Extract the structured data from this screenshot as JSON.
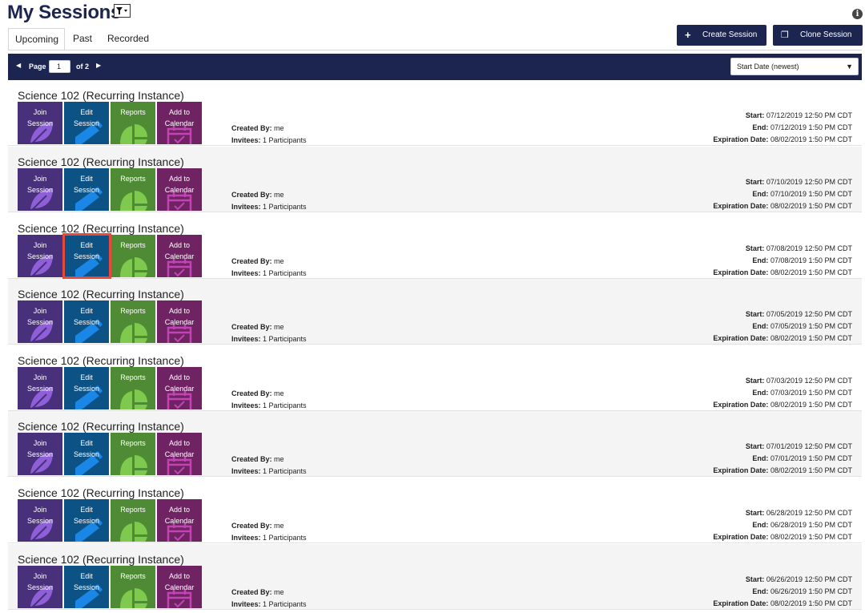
{
  "header": {
    "title": "My Sessions",
    "filter_icon": "funnel-icon",
    "info_icon": "info-icon",
    "info_glyph": "i"
  },
  "tabs": [
    {
      "label": "Upcoming",
      "active": true
    },
    {
      "label": "Past",
      "active": false
    },
    {
      "label": "Recorded",
      "active": false
    }
  ],
  "actions": {
    "create_label": "Create Session",
    "create_icon_glyph": "+",
    "clone_label": "Clone Session",
    "clone_icon_glyph": "❐"
  },
  "pager": {
    "prev_glyph": "◀",
    "next_glyph": "▶",
    "page_label": "Page",
    "page_value": "1",
    "of_label": "of 2",
    "sort_value": "Start Date (newest)",
    "sort_caret": "▼"
  },
  "labels": {
    "join": [
      "Join",
      "Session"
    ],
    "edit": [
      "Edit",
      "Session"
    ],
    "reports": "Reports",
    "calendar": [
      "Add to",
      "Calendar"
    ],
    "created_by": "Created By:",
    "invitees": "Invitees:",
    "start": "Start:",
    "end": "End:",
    "expiration": "Expiration Date:"
  },
  "colors": {
    "navy": "#1b2550",
    "join": "#48307a",
    "edit": "#0c5285",
    "reports": "#4f8a35",
    "calendar": "#6f2363",
    "highlight": "#e74a3b"
  },
  "sessions": [
    {
      "title": "Science 102 (Recurring Instance)",
      "created_by": "me",
      "invitees": "1 Participants",
      "start": "07/12/2019 12:50 PM CDT",
      "end": "07/12/2019 1:50 PM CDT",
      "expiration": "08/02/2019 1:50 PM CDT"
    },
    {
      "title": "Science 102 (Recurring Instance)",
      "created_by": "me",
      "invitees": "1 Participants",
      "start": "07/10/2019 12:50 PM CDT",
      "end": "07/10/2019 1:50 PM CDT",
      "expiration": "08/02/2019 1:50 PM CDT"
    },
    {
      "title": "Science 102 (Recurring Instance)",
      "created_by": "me",
      "invitees": "1 Participants",
      "start": "07/08/2019 12:50 PM CDT",
      "end": "07/08/2019 1:50 PM CDT",
      "expiration": "08/02/2019 1:50 PM CDT",
      "highlight_edit": true
    },
    {
      "title": "Science 102 (Recurring Instance)",
      "created_by": "me",
      "invitees": "1 Participants",
      "start": "07/05/2019 12:50 PM CDT",
      "end": "07/05/2019 1:50 PM CDT",
      "expiration": "08/02/2019 1:50 PM CDT"
    },
    {
      "title": "Science 102 (Recurring Instance)",
      "created_by": "me",
      "invitees": "1 Participants",
      "start": "07/03/2019 12:50 PM CDT",
      "end": "07/03/2019 1:50 PM CDT",
      "expiration": "08/02/2019 1:50 PM CDT"
    },
    {
      "title": "Science 102 (Recurring Instance)",
      "created_by": "me",
      "invitees": "1 Participants",
      "start": "07/01/2019 12:50 PM CDT",
      "end": "07/01/2019 1:50 PM CDT",
      "expiration": "08/02/2019 1:50 PM CDT"
    },
    {
      "title": "Science 102 (Recurring Instance)",
      "created_by": "me",
      "invitees": "1 Participants",
      "start": "06/28/2019 12:50 PM CDT",
      "end": "06/28/2019 1:50 PM CDT",
      "expiration": "08/02/2019 1:50 PM CDT"
    },
    {
      "title": "Science 102 (Recurring Instance)",
      "created_by": "me",
      "invitees": "1 Participants",
      "start": "06/26/2019 12:50 PM CDT",
      "end": "06/26/2019 1:50 PM CDT",
      "expiration": "08/02/2019 1:50 PM CDT"
    }
  ]
}
